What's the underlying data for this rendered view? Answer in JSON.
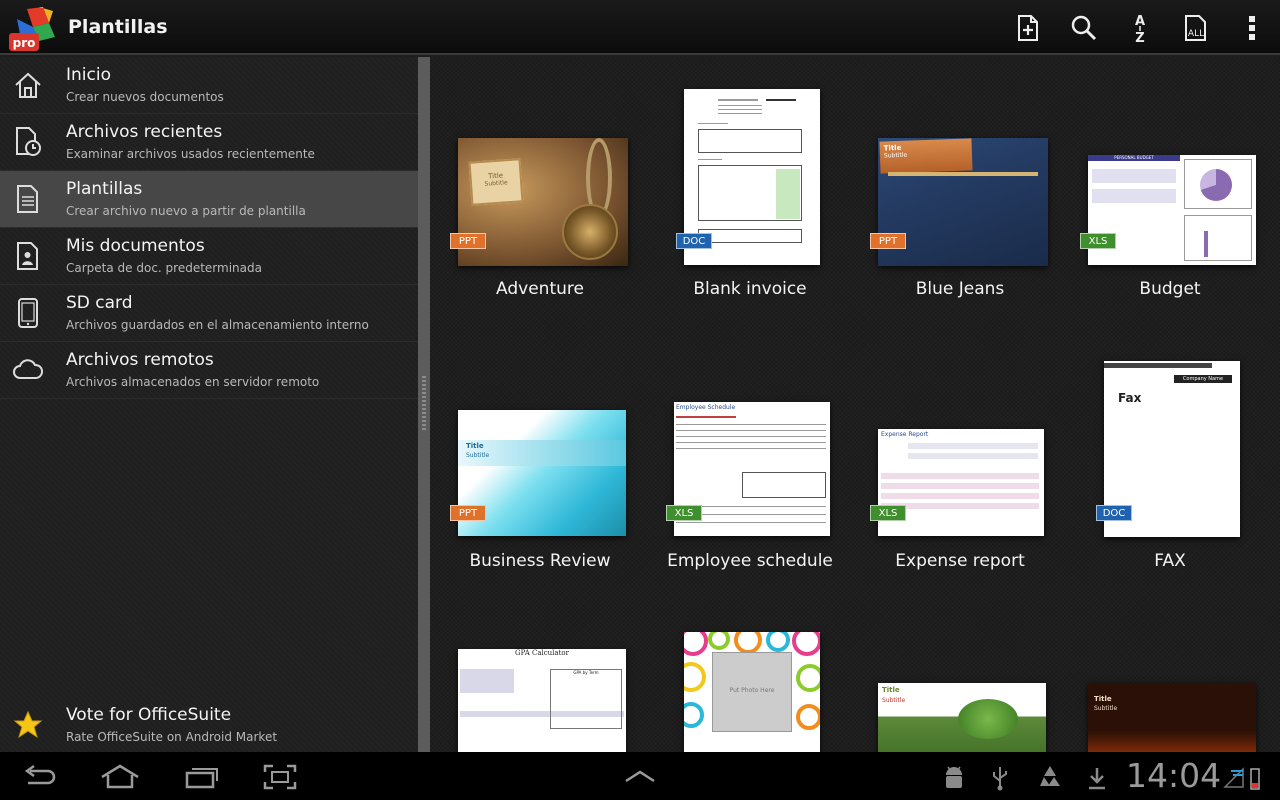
{
  "actionbar": {
    "logo_text": "pro",
    "title": "Plantillas",
    "icons": [
      "new-document-icon",
      "search-icon",
      "sort-az-icon",
      "all-files-icon",
      "overflow-menu-icon"
    ],
    "sort_label": "A↓Z",
    "all_label": "ALL"
  },
  "sidebar": {
    "items": [
      {
        "icon": "home-icon",
        "title": "Inicio",
        "subtitle": "Crear nuevos documentos"
      },
      {
        "icon": "recent-files-icon",
        "title": "Archivos recientes",
        "subtitle": "Examinar archivos usados recientemente"
      },
      {
        "icon": "templates-icon",
        "title": "Plantillas",
        "subtitle": "Crear archivo nuevo a partir de plantilla",
        "selected": true
      },
      {
        "icon": "my-documents-icon",
        "title": "Mis documentos",
        "subtitle": "Carpeta de doc. predeterminada"
      },
      {
        "icon": "sd-card-icon",
        "title": "SD card",
        "subtitle": "Archivos guardados en el almacenamiento interno"
      },
      {
        "icon": "cloud-icon",
        "title": "Archivos remotos",
        "subtitle": "Archivos almacenados en servidor remoto"
      }
    ],
    "vote": {
      "icon": "star-icon",
      "title": "Vote for OfficeSuite",
      "subtitle": "Rate OfficeSuite on Android Market"
    }
  },
  "templates": [
    {
      "name": "Adventure",
      "type": "PPT",
      "thumb_title": "Title",
      "thumb_subtitle": "Subtitle"
    },
    {
      "name": "Blank invoice",
      "type": "DOC"
    },
    {
      "name": "Blue Jeans",
      "type": "PPT",
      "thumb_title": "Title",
      "thumb_subtitle": "Subtitle"
    },
    {
      "name": "Budget",
      "type": "XLS",
      "thumb_title": "PERSONAL BUDGET"
    },
    {
      "name": "Business Review",
      "type": "PPT",
      "thumb_title": "Title",
      "thumb_subtitle": "Subtitle"
    },
    {
      "name": "Employee schedule",
      "type": "XLS",
      "thumb_title": "Employee Schedule"
    },
    {
      "name": "Expense report",
      "type": "XLS",
      "thumb_title": "Expense Report"
    },
    {
      "name": "FAX",
      "type": "DOC",
      "thumb_title": "Fax",
      "thumb_company": "Company Name"
    },
    {
      "name": "",
      "type": "",
      "thumb_title": "GPA Calculator",
      "thumb_chart": "GPA by Term"
    },
    {
      "name": "",
      "type": "",
      "thumb_title": "Put Photo Here"
    },
    {
      "name": "",
      "type": "",
      "thumb_title": "Title",
      "thumb_subtitle": "Subtitle"
    },
    {
      "name": "",
      "type": "",
      "thumb_title": "Title",
      "thumb_subtitle": "Subtitle"
    }
  ],
  "badge_colors": {
    "PPT": "#e0712a",
    "DOC": "#1f63b0",
    "XLS": "#3f8f2e"
  },
  "sysbar": {
    "time": "14:04",
    "icons": [
      "back-icon",
      "home-nav-icon",
      "recent-apps-icon",
      "screenshot-icon",
      "app-drawer-chevron-icon",
      "android-debug-icon",
      "usb-icon",
      "recycle-icon",
      "download-icon",
      "signal-battery-icon"
    ]
  }
}
